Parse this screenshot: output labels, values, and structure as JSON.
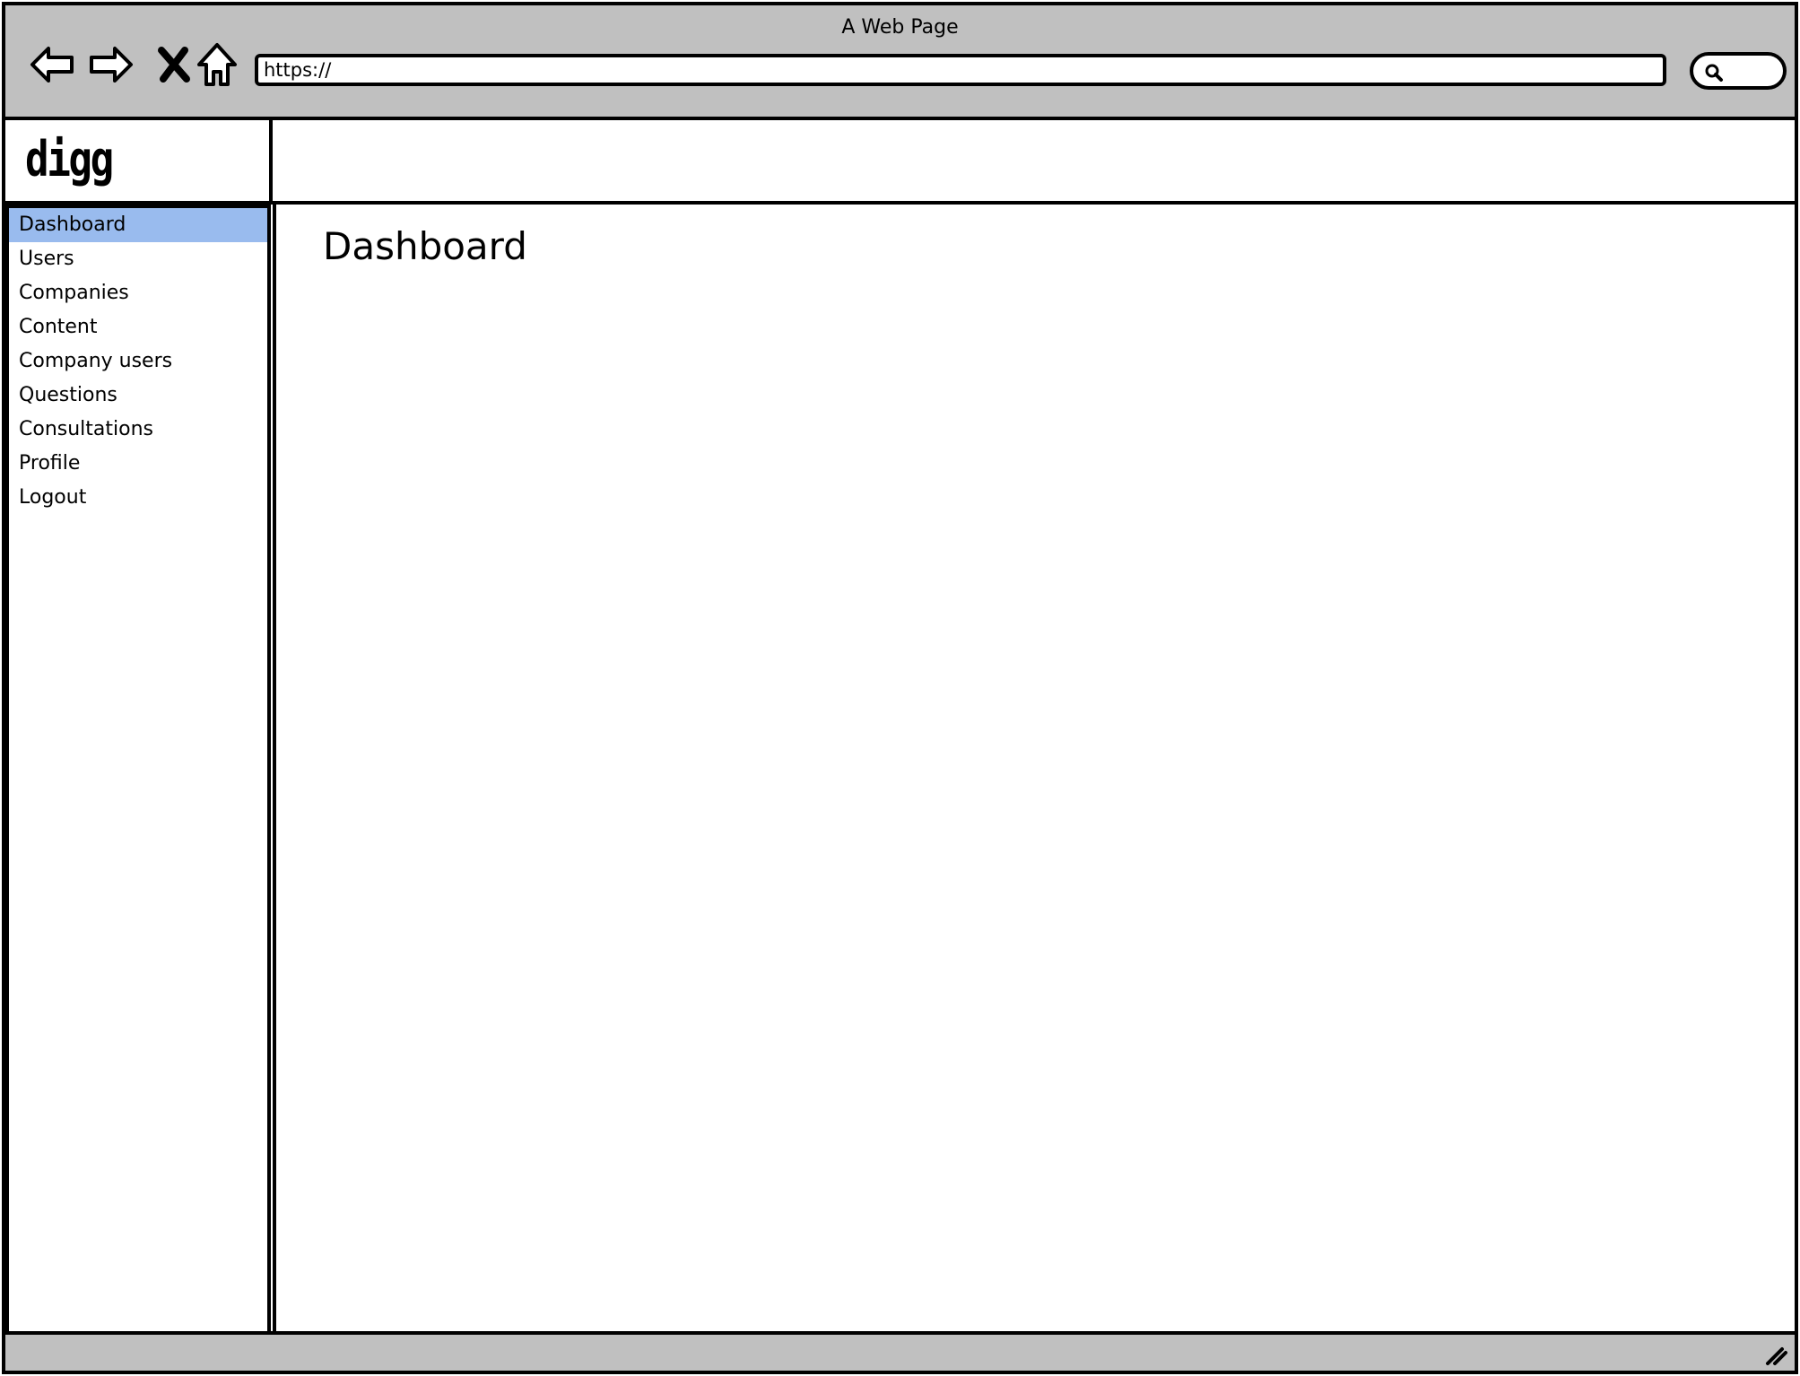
{
  "window": {
    "title": "A Web Page"
  },
  "toolbar": {
    "url_value": "https://",
    "icons": [
      "back-arrow-icon",
      "forward-arrow-icon",
      "stop-icon",
      "home-icon",
      "search-icon"
    ]
  },
  "brand": {
    "logo_text": "digg"
  },
  "sidebar": {
    "items": [
      {
        "label": "Dashboard",
        "active": true
      },
      {
        "label": "Users",
        "active": false
      },
      {
        "label": "Companies",
        "active": false
      },
      {
        "label": "Content",
        "active": false
      },
      {
        "label": "Company users",
        "active": false
      },
      {
        "label": "Questions",
        "active": false
      },
      {
        "label": "Consultations",
        "active": false
      },
      {
        "label": "Profile",
        "active": false
      },
      {
        "label": "Logout",
        "active": false
      }
    ]
  },
  "main": {
    "title": "Dashboard"
  },
  "colors": {
    "chrome": "#c0c0c0",
    "active_item": "#99bbee",
    "border": "#000000",
    "background": "#ffffff"
  }
}
